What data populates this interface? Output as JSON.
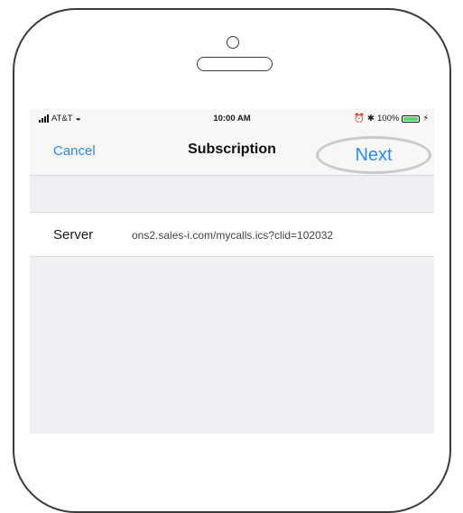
{
  "status_bar": {
    "carrier": "AT&T",
    "time": "10:00 AM",
    "battery": "100%",
    "battery_level": 1.0,
    "icons": [
      "signal-icon",
      "wifi-icon",
      "alarm-icon",
      "bluetooth-icon",
      "battery-icon",
      "charging-icon"
    ]
  },
  "nav": {
    "cancel_label": "Cancel",
    "title": "Subscription",
    "next_label": "Next"
  },
  "form": {
    "server_label": "Server",
    "server_value": "ons2.sales-i.com/mycalls.ics?clid=102032"
  },
  "colors": {
    "accent": "#2b8bef",
    "background": "#efeff4",
    "battery": "#4cd964",
    "highlight_ring": "#c9c9c9"
  }
}
